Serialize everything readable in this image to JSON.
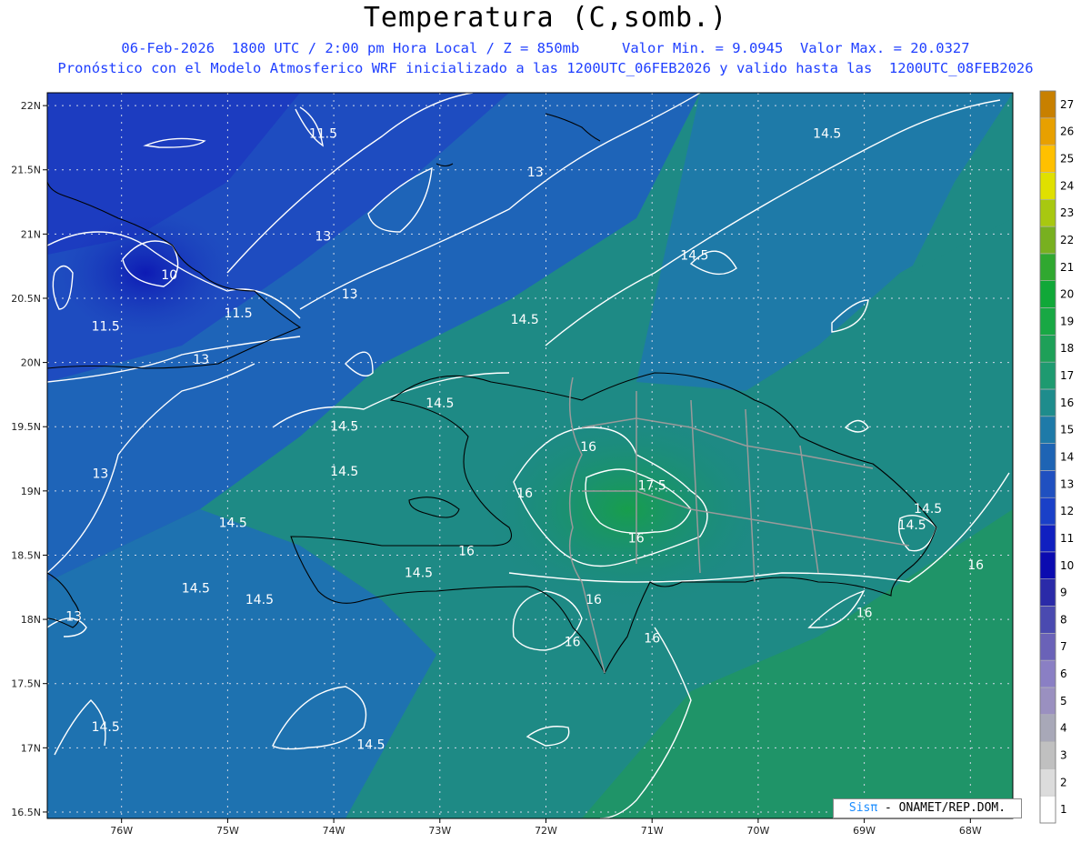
{
  "title": "Temperatura (C,somb.)",
  "subtitle_line1": "06-Feb-2026  1800 UTC / 2:00 pm Hora Local / Z = 850mb     Valor Min. = 9.0945  Valor Max. = 20.0327",
  "subtitle_line2": "Pronóstico con el Modelo Atmosferico WRF inicializado a las 1200UTC_06FEB2026 y valido hasta las  1200UTC_08FEB2026",
  "credit": {
    "logo": "Sisπ",
    "text": " - ONAMET/REP.DOM."
  },
  "chart_data": {
    "type": "heatmap",
    "variable": "Temperatura (C)",
    "level": "850mb",
    "valid_time": "06-Feb-2026 1800 UTC",
    "value_min": 9.0945,
    "value_max": 20.0327,
    "x_axis": {
      "lim": [
        -76.7,
        -67.6
      ],
      "ticks": [
        -76,
        -75,
        -74,
        -73,
        -72,
        -71,
        -70,
        -69,
        -68
      ],
      "tick_labels": [
        "76W",
        "75W",
        "74W",
        "73W",
        "72W",
        "71W",
        "70W",
        "69W",
        "68W"
      ]
    },
    "y_axis": {
      "lim": [
        16.45,
        22.1
      ],
      "ticks": [
        16.5,
        17,
        17.5,
        18,
        18.5,
        19,
        19.5,
        20,
        20.5,
        21,
        21.5,
        22
      ],
      "tick_labels": [
        "16.5N",
        "17N",
        "17.5N",
        "18N",
        "18.5N",
        "19N",
        "19.5N",
        "20N",
        "20.5N",
        "21N",
        "21.5N",
        "22N"
      ]
    },
    "grid": true,
    "colorbar": {
      "labels": [
        "1",
        "2",
        "3",
        "4",
        "5",
        "6",
        "7",
        "8",
        "9",
        "10",
        "11",
        "12",
        "13",
        "14",
        "15",
        "16",
        "17",
        "18",
        "19",
        "20",
        "21",
        "22",
        "23",
        "24",
        "25",
        "26",
        "27"
      ],
      "colors": [
        "#ffffff",
        "#dcdcdc",
        "#c0c0c0",
        "#a8a8b8",
        "#9a90c0",
        "#8a7fc4",
        "#6a62b8",
        "#4a4ab0",
        "#2a2aa8",
        "#0b0bb0",
        "#1020c0",
        "#1a40c8",
        "#2050c0",
        "#1e64b4",
        "#1e7aa8",
        "#1e8c8c",
        "#1e9a70",
        "#1ea058",
        "#18a844",
        "#10a838",
        "#30a830",
        "#78b020",
        "#a8c810",
        "#e0e000",
        "#ffc000",
        "#e8a000",
        "#c88000"
      ]
    },
    "contours": [
      {
        "value": 10,
        "label": "10",
        "lon": -75.55,
        "lat": 20.65
      },
      {
        "value": 11.5,
        "label": "11.5",
        "lon": -74.1,
        "lat": 21.75
      },
      {
        "value": 11.5,
        "label": "11.5",
        "lon": -76.15,
        "lat": 20.25
      },
      {
        "value": 11.5,
        "label": "11.5",
        "lon": -74.9,
        "lat": 20.35
      },
      {
        "value": 13,
        "label": "13",
        "lon": -72.1,
        "lat": 21.45
      },
      {
        "value": 13,
        "label": "13",
        "lon": -74.1,
        "lat": 20.95
      },
      {
        "value": 13,
        "label": "13",
        "lon": -73.85,
        "lat": 20.5
      },
      {
        "value": 13,
        "label": "13",
        "lon": -75.25,
        "lat": 19.99
      },
      {
        "value": 13,
        "label": "13",
        "lon": -76.2,
        "lat": 19.1
      },
      {
        "value": 13,
        "label": "13",
        "lon": -76.45,
        "lat": 17.99
      },
      {
        "value": 14.5,
        "label": "14.5",
        "lon": -69.35,
        "lat": 21.75
      },
      {
        "value": 14.5,
        "label": "14.5",
        "lon": -70.6,
        "lat": 20.8
      },
      {
        "value": 14.5,
        "label": "14.5",
        "lon": -72.2,
        "lat": 20.3
      },
      {
        "value": 14.5,
        "label": "14.5",
        "lon": -73.0,
        "lat": 19.65
      },
      {
        "value": 14.5,
        "label": "14.5",
        "lon": -73.9,
        "lat": 19.47
      },
      {
        "value": 14.5,
        "label": "14.5",
        "lon": -73.9,
        "lat": 19.12
      },
      {
        "value": 14.5,
        "label": "14.5",
        "lon": -74.95,
        "lat": 18.72
      },
      {
        "value": 14.5,
        "label": "14.5",
        "lon": -73.2,
        "lat": 18.33
      },
      {
        "value": 14.5,
        "label": "14.5",
        "lon": -75.3,
        "lat": 18.21
      },
      {
        "value": 14.5,
        "label": "14.5",
        "lon": -74.7,
        "lat": 18.12
      },
      {
        "value": 14.5,
        "label": "14.5",
        "lon": -76.15,
        "lat": 17.13
      },
      {
        "value": 14.5,
        "label": "14.5",
        "lon": -73.65,
        "lat": 16.99
      },
      {
        "value": 14.5,
        "label": "14.5",
        "lon": -68.4,
        "lat": 18.83
      },
      {
        "value": 14.5,
        "label": "14.5",
        "lon": -68.55,
        "lat": 18.7
      },
      {
        "value": 16,
        "label": "16",
        "lon": -71.6,
        "lat": 19.31
      },
      {
        "value": 16,
        "label": "16",
        "lon": -72.2,
        "lat": 18.95
      },
      {
        "value": 16,
        "label": "16",
        "lon": -72.75,
        "lat": 18.5
      },
      {
        "value": 16,
        "label": "16",
        "lon": -71.15,
        "lat": 18.6
      },
      {
        "value": 16,
        "label": "16",
        "lon": -71.55,
        "lat": 18.12
      },
      {
        "value": 16,
        "label": "16",
        "lon": -71.75,
        "lat": 17.79
      },
      {
        "value": 16,
        "label": "16",
        "lon": -71.0,
        "lat": 17.82
      },
      {
        "value": 16,
        "label": "16",
        "lon": -69.0,
        "lat": 18.02
      },
      {
        "value": 16,
        "label": "16",
        "lon": -67.95,
        "lat": 18.39
      },
      {
        "value": 17.5,
        "label": "17.5",
        "lon": -71.0,
        "lat": 19.01
      }
    ]
  }
}
